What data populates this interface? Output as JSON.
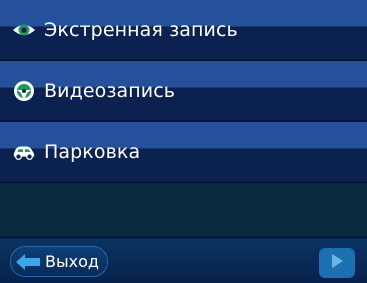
{
  "menu": {
    "items": [
      {
        "id": "emergency",
        "label": "Экстренная запись",
        "icon": "eye-icon"
      },
      {
        "id": "video",
        "label": "Видеозапись",
        "icon": "steering-wheel-icon"
      },
      {
        "id": "parking",
        "label": "Парковка",
        "icon": "car-icon"
      }
    ]
  },
  "footer": {
    "exit_label": "Выход",
    "next_icon": "play-arrow-icon"
  },
  "colors": {
    "band_light": "#25509a",
    "band_dark": "#0b2250",
    "accent_blue": "#1c6fb0",
    "icon_green": "#1e9a5a"
  }
}
